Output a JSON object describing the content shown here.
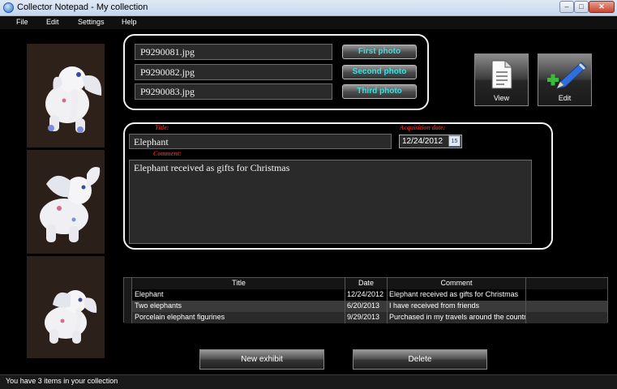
{
  "window": {
    "title": "Collector Notepad - My collection"
  },
  "menu": [
    "File",
    "Edit",
    "Settings",
    "Help"
  ],
  "photos": {
    "files": [
      "P9290081.jpg",
      "P9290082.jpg",
      "P9290083.jpg"
    ],
    "buttons": [
      "First photo",
      "Second photo",
      "Third photo"
    ],
    "button_text_color": "#37e2e2"
  },
  "actions": {
    "view": "View",
    "edit": "Edit"
  },
  "details": {
    "title_label": "Title:",
    "title_value": "Elephant",
    "date_label": "Acquisition date:",
    "date_value": "12/24/2012",
    "calendar_day": "15",
    "comment_label": "Comment:",
    "comment_value": "Elephant received as gifts for Christmas",
    "label_color": "#e41b1b"
  },
  "table": {
    "columns": [
      "Title",
      "Date",
      "Comment"
    ],
    "rows": [
      [
        "Elephant",
        "12/24/2012",
        "Elephant received as gifts for Christmas"
      ],
      [
        "Two elephants",
        "6/20/2013",
        "I have received from friends"
      ],
      [
        "Porcelain elephant figurines",
        "9/29/2013",
        "Purchased in my travels around the country"
      ]
    ]
  },
  "buttons": {
    "new_exhibit": "New exhibit",
    "delete": "Delete"
  },
  "status": "You have 3 items in your collection"
}
